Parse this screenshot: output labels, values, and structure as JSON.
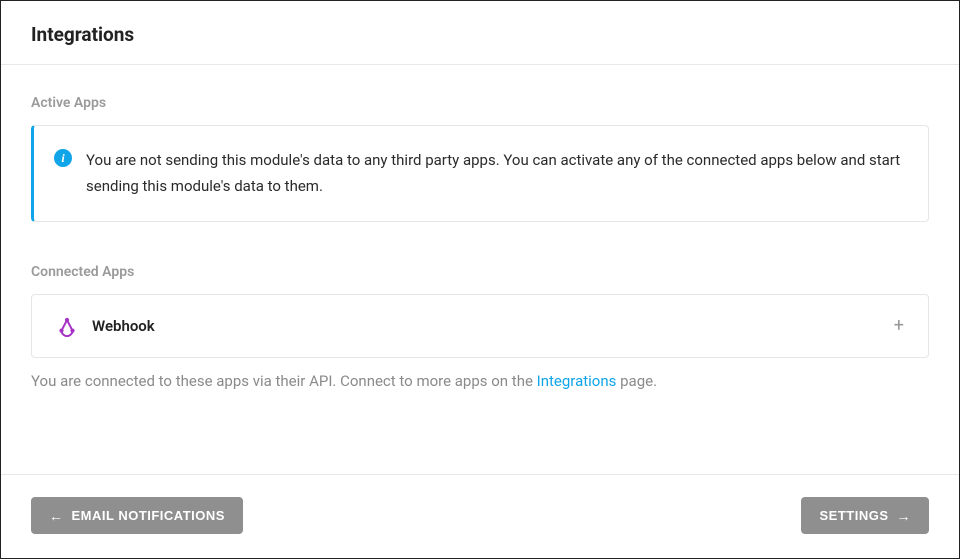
{
  "header": {
    "title": "Integrations"
  },
  "activeApps": {
    "label": "Active Apps",
    "infoIcon": "i",
    "infoMessage": "You are not sending this module's data to any third party apps. You can activate any of the connected apps below and start sending this module's data to them."
  },
  "connectedApps": {
    "label": "Connected Apps",
    "items": [
      {
        "name": "Webhook",
        "icon": "webhook-icon"
      }
    ],
    "helperPre": "You are connected to these apps via their API. Connect to more apps on the ",
    "helperLink": "Integrations",
    "helperPost": " page."
  },
  "footer": {
    "backLabel": "EMAIL NOTIFICATIONS",
    "nextLabel": "SETTINGS"
  }
}
